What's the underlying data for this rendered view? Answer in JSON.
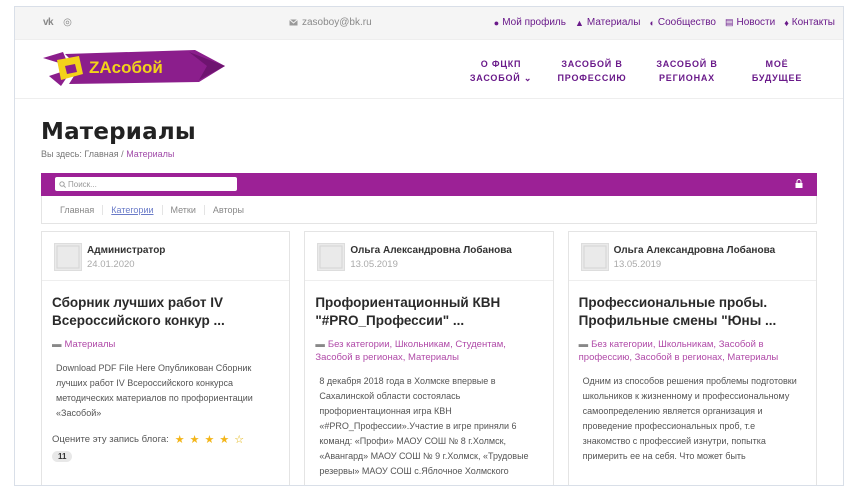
{
  "topbar": {
    "social": [
      {
        "icon": "vk-icon",
        "label": "vk"
      },
      {
        "icon": "instagram-icon",
        "label": "◎"
      }
    ],
    "email": "zasoboy@bk.ru",
    "nav": [
      {
        "icon": "user-icon",
        "label": "Мой профиль"
      },
      {
        "icon": "graduation-cap-icon",
        "label": "Материалы"
      },
      {
        "icon": "comments-icon",
        "label": "Сообщество"
      },
      {
        "icon": "newspaper-icon",
        "label": "Новости"
      },
      {
        "icon": "map-marker-icon",
        "label": "Контакты"
      }
    ]
  },
  "logo": {
    "text": "ZAсобой"
  },
  "mainnav": [
    {
      "line1": "О ФЦКП",
      "line2": "ЗАСОБОЙ ⌄"
    },
    {
      "line1": "ЗАСОБОЙ В",
      "line2": "ПРОФЕССИЮ"
    },
    {
      "line1": "ЗАСОБОЙ В",
      "line2": "РЕГИОНАХ"
    },
    {
      "line1": "МОЁ",
      "line2": "БУДУЩЕЕ"
    }
  ],
  "page": {
    "title": "Материалы",
    "crumb_prefix": "Вы здесь:",
    "crumb_home": "Главная",
    "crumb_sep": "/",
    "crumb_current": "Материалы"
  },
  "search": {
    "placeholder": "Поиск..."
  },
  "tabs": [
    "Главная",
    "Категории",
    "Метки",
    "Авторы"
  ],
  "cards": [
    {
      "author": "Администратор",
      "date": "24.01.2020",
      "title": "Сборник лучших работ IV Всероссийского конкур ...",
      "cats": "Материалы",
      "text": "Download PDF File Here Опубликован Сборник лучших работ IV Всероссийского конкурса методических материалов по профориентации «Засобой»",
      "rating_label": "Оцените эту запись блога:",
      "rating": 4,
      "rating_max": 5,
      "count": "11"
    },
    {
      "author": "Ольга Александровна Лобанова",
      "date": "13.05.2019",
      "title": "Профориентационный КВН \"#PRO_Профессии\" ...",
      "cats": "Без категории, Школьникам, Студентам, Засобой в регионах, Материалы",
      "text": "8 декабря 2018 года в Холмске впервые в Сахалинской области состоялась профориентационная игра КВН «#PRO_Профессии».Участие в игре приняли 6 команд: «Профи» МАОУ СОШ № 8 г.Холмск, «Авангард» МАОУ СОШ № 9 г.Холмск, «Трудовые резервы» МАОУ СОШ с.Яблочное Холмского"
    },
    {
      "author": "Ольга Александровна Лобанова",
      "date": "13.05.2019",
      "title": "Профессиональные пробы. Профильные смены \"Юны ...",
      "cats": "Без категории, Школьникам, Засобой в профессию, Засобой в регионах, Материалы",
      "text": "Одним из способов решения проблемы подготовки школьников к жизненному и профессиональному самоопределению является организация и проведение профессиональных проб, т.е знакомство с профессией изнутри, попытка примерить ее на себя. Что может быть"
    }
  ],
  "colors": {
    "brand": "#9c2196",
    "nav": "#6a1a8a",
    "star": "#f3b518"
  }
}
